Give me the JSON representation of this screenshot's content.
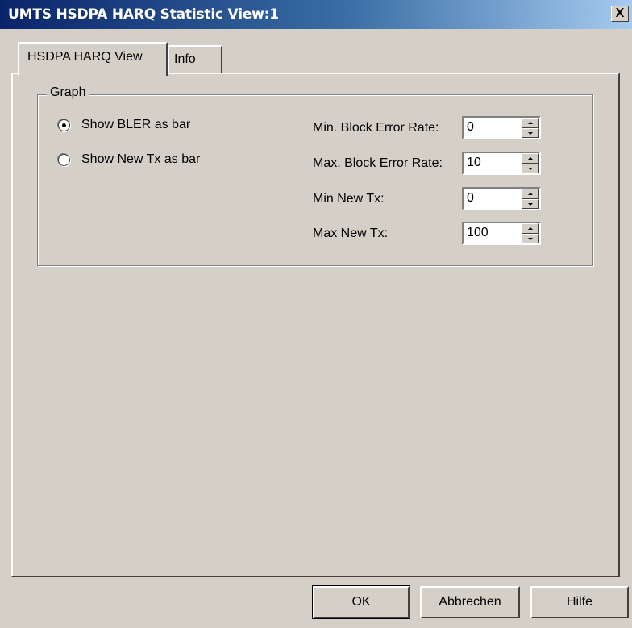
{
  "window": {
    "title": "UMTS HSDPA HARQ Statistic View:1",
    "close_label": "X"
  },
  "tabs": [
    {
      "label": "HSDPA HARQ View",
      "active": true
    },
    {
      "label": "Info",
      "active": false
    }
  ],
  "graph_group": {
    "legend": "Graph",
    "options": [
      {
        "label": "Show BLER as bar",
        "checked": true
      },
      {
        "label": "Show New Tx as bar",
        "checked": false
      }
    ],
    "fields": [
      {
        "label": "Min. Block Error Rate:",
        "value": "0"
      },
      {
        "label": "Max. Block Error Rate:",
        "value": "10"
      },
      {
        "label": "Min New Tx:",
        "value": "0"
      },
      {
        "label": "Max New Tx:",
        "value": "100"
      }
    ]
  },
  "buttons": {
    "ok": "OK",
    "cancel": "Abbrechen",
    "help": "Hilfe"
  },
  "colors": {
    "face": "#d4d0c8",
    "titlebar_start": "#0a246a",
    "titlebar_end": "#a6caf0"
  }
}
